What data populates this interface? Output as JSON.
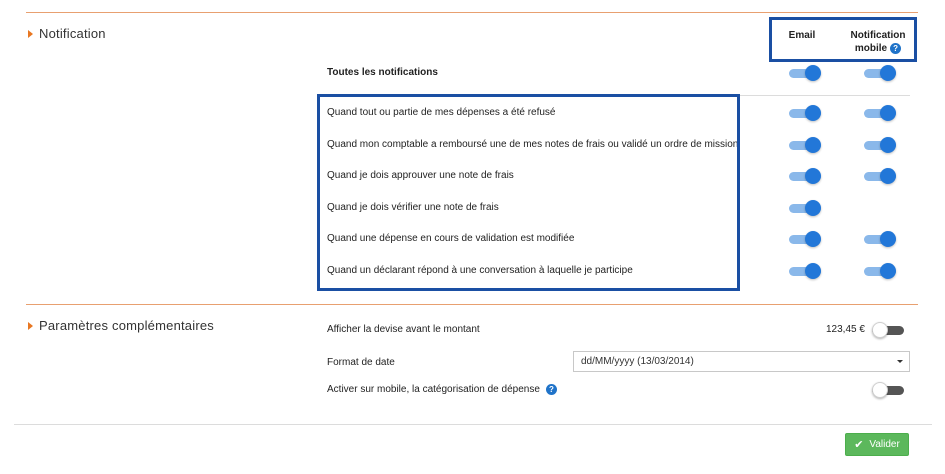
{
  "notification": {
    "section_title": "Notification",
    "col_email": "Email",
    "col_mobile_line1": "Notification",
    "col_mobile_line2": "mobile",
    "help_glyph": "?",
    "all_label": "Toutes les notifications",
    "all_email": true,
    "all_mobile": true,
    "rows": [
      {
        "label": "Quand tout ou partie de mes dépenses a été refusé",
        "email": true,
        "mobile": true
      },
      {
        "label": "Quand mon comptable a remboursé une de mes notes de frais ou validé un ordre de mission",
        "email": true,
        "mobile": true
      },
      {
        "label": "Quand je dois approuver une note de frais",
        "email": true,
        "mobile": true
      },
      {
        "label": "Quand je dois vérifier une note de frais",
        "email": true,
        "mobile": null
      },
      {
        "label": "Quand une dépense en cours de validation est modifiée",
        "email": true,
        "mobile": true
      },
      {
        "label": "Quand un déclarant répond à une conversation à laquelle je participe",
        "email": true,
        "mobile": true
      }
    ]
  },
  "params": {
    "section_title": "Paramètres complémentaires",
    "currency_label": "Afficher la devise avant le montant",
    "currency_preview": "123,45 €",
    "currency_toggle": false,
    "date_label": "Format de date",
    "date_value": "dd/MM/yyyy (13/03/2014)",
    "mobile_cat_label": "Activer sur mobile, la catégorisation de dépense",
    "mobile_cat_toggle": false
  },
  "footer": {
    "validate_label": "Valider",
    "check_glyph": "✔"
  },
  "colors": {
    "accent_orange": "#e87722",
    "toggle_on": "#2277d8",
    "highlight_box": "#1a4fa3",
    "validate_green": "#5cb85c"
  }
}
